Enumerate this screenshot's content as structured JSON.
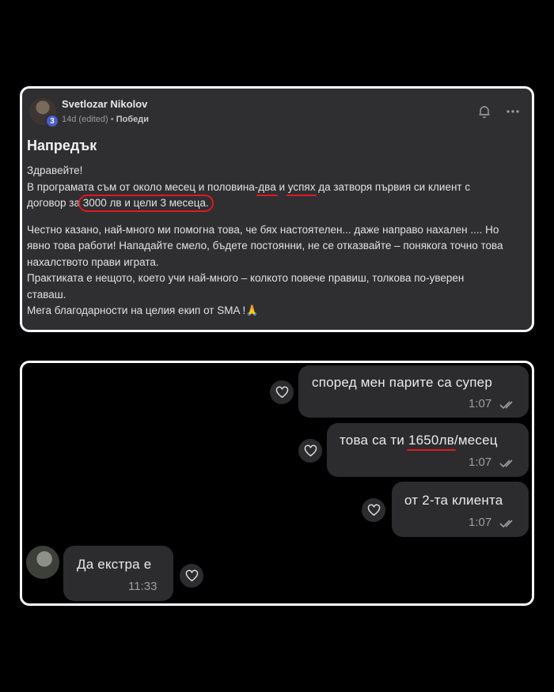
{
  "post": {
    "author": "Svetlozar Nikolov",
    "level": "3",
    "age": "14d (edited)",
    "separator": "•",
    "category": "Победи",
    "title": "Напредък",
    "greeting": "Здравейте!",
    "line2_pre": "В програмата съм от около месец и половина-",
    "line2_u1": "два",
    "line2_mid": " и ",
    "line2_u2": "успях",
    "line2_post": " да затворя първия си клиент с",
    "line3_pre": "договор за ",
    "line3_circled": "3000 лв и цели 3 месеца.",
    "p2_l1": "Честно казано, най-много ми помогна това, че бях настоятелен... даже направо нахален .... Но",
    "p2_l2": "явно това работи! Нападайте смело, бъдете постоянни, не се отказвайте – понякога точно това",
    "p2_l3": "нахалството прави играта.",
    "p2_l4": "Практиката е нещото, което учи най-много – колкото повече правиш, толкова по-уверен",
    "p2_l5": "ставаш.",
    "p2_l6": "Мега благодарности на целия екип от SMA !🙏"
  },
  "chat": {
    "messages": [
      {
        "text": "според мен парите са супер",
        "time": "1:07"
      },
      {
        "text_pre": "това са ти ",
        "text_u": "1650лв",
        "text_post": "/месец",
        "time": "1:07"
      },
      {
        "text": "от 2-та клиента",
        "time": "1:07"
      },
      {
        "text": "Да екстра е",
        "time": "11:33"
      }
    ]
  },
  "colors": {
    "accent_red": "#e01822",
    "card_bg": "#2f2f31",
    "bubble_bg": "#2c2c2e",
    "frame": "#ffffff"
  }
}
